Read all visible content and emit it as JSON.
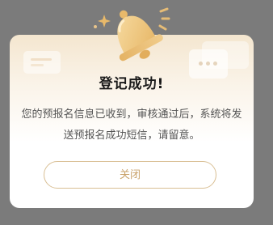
{
  "dialog": {
    "title": "登记成功!",
    "message": "您的预报名信息已收到，审核通过后，系统将发送预报名成功短信，请留意。",
    "close_label": "关闭"
  },
  "icons": {
    "bell": "bell-icon",
    "sparkle": "sparkle-icon"
  },
  "colors": {
    "overlay": "#7b7b7b",
    "accent": "#c9a26a",
    "bell": "#f0cc8a"
  }
}
